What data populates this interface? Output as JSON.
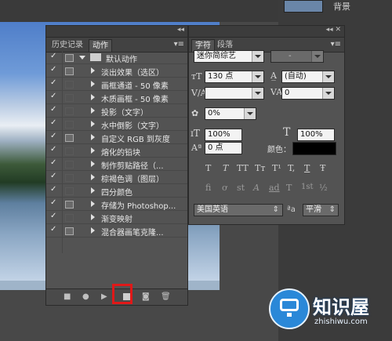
{
  "background": {
    "layer_name": "背景"
  },
  "actions_panel": {
    "tabs": [
      "历史记录",
      "动作"
    ],
    "active_tab": "动作",
    "action_set": "默认动作",
    "actions": [
      {
        "label": "淡出效果（选区）",
        "dialog": true
      },
      {
        "label": "画框通道 - 50 像素",
        "dialog": false
      },
      {
        "label": "木质画框 - 50 像素",
        "dialog": false
      },
      {
        "label": "投影（文字）",
        "dialog": false
      },
      {
        "label": "水中倒影（文字）",
        "dialog": false
      },
      {
        "label": "自定义 RGB 到灰度",
        "dialog": true
      },
      {
        "label": "熔化的铅块",
        "dialog": false
      },
      {
        "label": "制作剪贴路径（...",
        "dialog": false
      },
      {
        "label": "棕褐色调（图层）",
        "dialog": false
      },
      {
        "label": "四分颜色",
        "dialog": false
      },
      {
        "label": "存储为 Photoshop...",
        "dialog": true
      },
      {
        "label": "渐变映射",
        "dialog": false
      },
      {
        "label": "混合器画笔克隆...",
        "dialog": true
      }
    ],
    "highlight_color": "#e01818"
  },
  "character_panel": {
    "tabs": [
      "字符",
      "段落"
    ],
    "active_tab": "字符",
    "font_family": "迷你简综艺",
    "font_style": "-",
    "font_size": "130 点",
    "leading": "(自动)",
    "kerning": "",
    "tracking": "0",
    "tsume": "0%",
    "vertical_scale": "100%",
    "horizontal_scale": "100%",
    "baseline_shift": "0 点",
    "color_label": "颜色：",
    "color_value": "#000000",
    "language": "美国英语",
    "antialias": "平滑",
    "antialias_prefix": "ªa",
    "type_style_buttons": [
      "T",
      "T",
      "TT",
      "Tт",
      "T¹",
      "T,",
      "T",
      "Ŧ"
    ],
    "opentype_buttons": [
      "fi",
      "ơ",
      "st",
      "A",
      "ad",
      "T",
      "1st",
      "½"
    ]
  },
  "watermark": {
    "title": "知识屋",
    "url": "zhishiwu.com"
  }
}
